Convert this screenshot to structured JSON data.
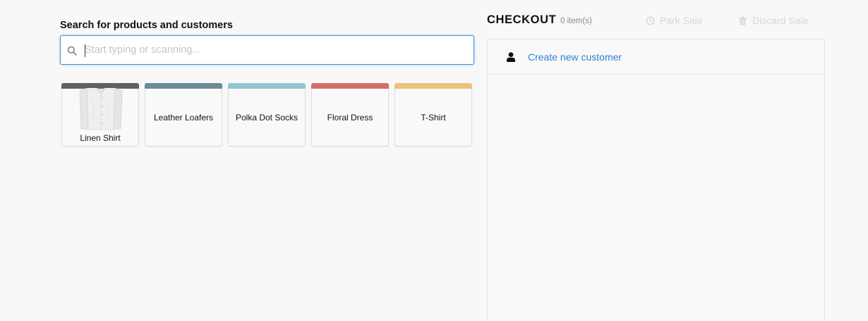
{
  "search": {
    "label": "Search for products and customers",
    "placeholder": "Start typing or scanning...",
    "value": ""
  },
  "products": [
    {
      "name": "Linen Shirt",
      "color": "#5f6165",
      "has_image": true
    },
    {
      "name": "Leather Loafers",
      "color": "#6b8c96",
      "has_image": false
    },
    {
      "name": "Polka Dot Socks",
      "color": "#93c5d0",
      "has_image": false
    },
    {
      "name": "Floral Dress",
      "color": "#d46d6a",
      "has_image": false
    },
    {
      "name": "T-Shirt",
      "color": "#eec07a",
      "has_image": false
    }
  ],
  "checkout": {
    "title": "CHECKOUT",
    "item_count": "0 item(s)",
    "park_label": "Park Sale",
    "discard_label": "Discard Sale",
    "create_customer_label": "Create new customer"
  },
  "colors": {
    "link": "#2f7fd1",
    "focus_border": "#3d8fd6",
    "disabled_text": "#d6d6d6"
  }
}
